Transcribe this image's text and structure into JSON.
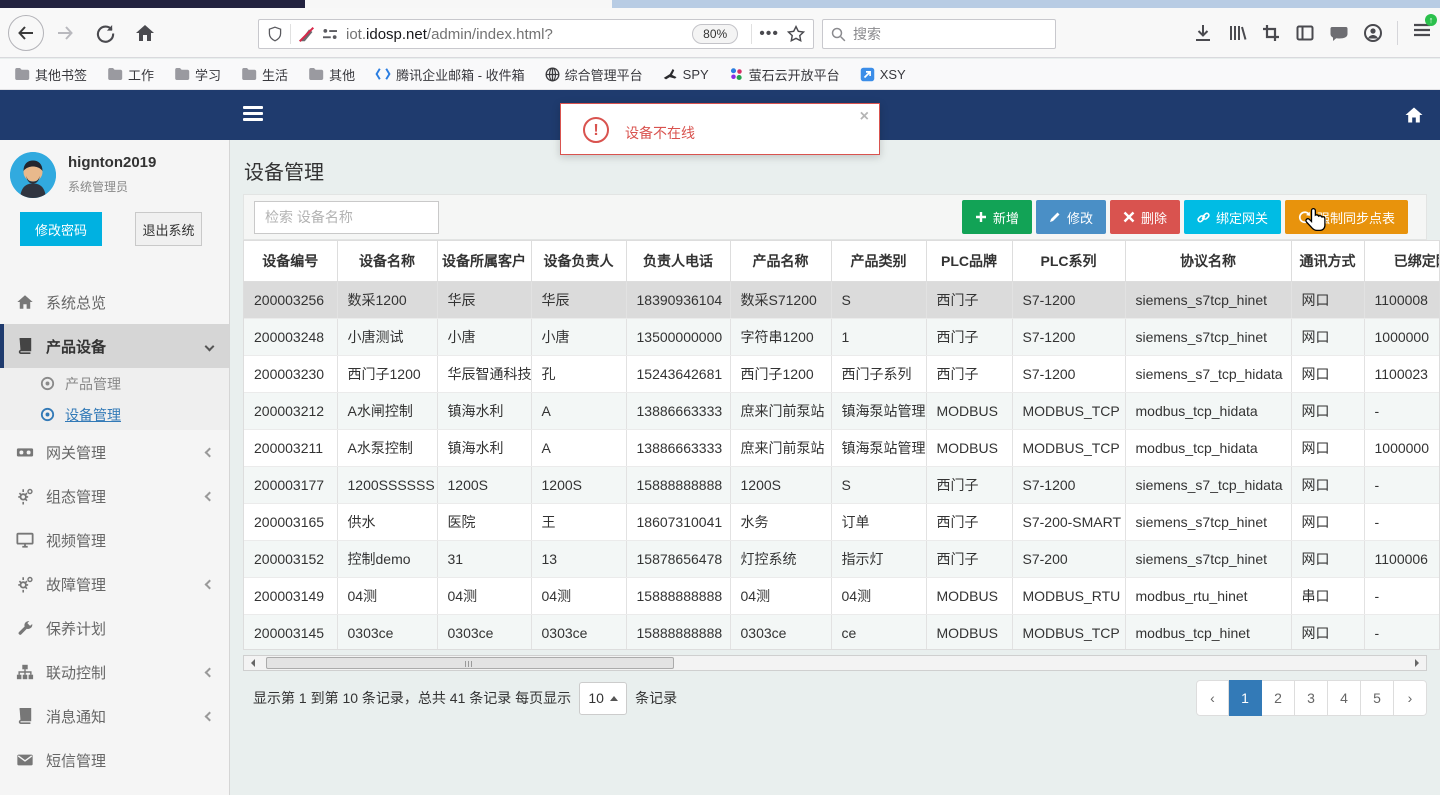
{
  "browser": {
    "url_prefix": "iot.",
    "url_domain": "idosp.net",
    "url_path": "/admin/index.html?",
    "zoom_level": "80%",
    "search_placeholder": "搜索",
    "bookmarks": [
      "其他书签",
      "工作",
      "学习",
      "生活",
      "其他",
      "腾讯企业邮箱 - 收件箱",
      "综合管理平台",
      "SPY",
      "萤石云开放平台",
      "XSY"
    ]
  },
  "app": {
    "alert": {
      "text": "设备不在线",
      "close": "×"
    },
    "user": {
      "name": "hignton2019",
      "role": "系统管理员",
      "change_password": "修改密码",
      "logout": "退出系统"
    },
    "menu": [
      {
        "label": "系统总览"
      },
      {
        "label": "产品设备"
      },
      {
        "label": "网关管理"
      },
      {
        "label": "组态管理"
      },
      {
        "label": "视频管理"
      },
      {
        "label": "故障管理"
      },
      {
        "label": "保养计划"
      },
      {
        "label": "联动控制"
      },
      {
        "label": "消息通知"
      },
      {
        "label": "短信管理"
      }
    ],
    "submenu": [
      {
        "label": "产品管理"
      },
      {
        "label": "设备管理"
      }
    ],
    "page": {
      "title": "设备管理",
      "search_placeholder": "检索 设备名称",
      "toolbar_buttons": [
        {
          "label": "新增",
          "color": "#12a356",
          "icon": "plus-icon"
        },
        {
          "label": "修改",
          "color": "#4a8fc6",
          "icon": "pencil-icon"
        },
        {
          "label": "删除",
          "color": "#d9534f",
          "icon": "x-icon"
        },
        {
          "label": "绑定网关",
          "color": "#00bce4",
          "icon": "link-icon"
        },
        {
          "label": "强制同步点表",
          "color": "#e8930c",
          "icon": "refresh-icon"
        }
      ],
      "table": {
        "headers": [
          "设备编号",
          "设备名称",
          "设备所属客户",
          "设备负责人",
          "负责人电话",
          "产品名称",
          "产品类别",
          "PLC品牌",
          "PLC系列",
          "协议名称",
          "通讯方式",
          "已绑定网关"
        ],
        "selected_row_index": 0,
        "rows": [
          [
            "200003256",
            "数采1200",
            "华辰",
            "华辰",
            "18390936104",
            "数采S71200",
            "S",
            "西门子",
            "S7-1200",
            "siemens_s7tcp_hinet",
            "网口",
            "1100008"
          ],
          [
            "200003248",
            "小唐测试",
            "小唐",
            "小唐",
            "13500000000",
            "字符串1200",
            "1",
            "西门子",
            "S7-1200",
            "siemens_s7tcp_hinet",
            "网口",
            "1000000"
          ],
          [
            "200003230",
            "西门子1200",
            "华辰智通科技",
            "孔",
            "15243642681",
            "西门子1200",
            "西门子系列",
            "西门子",
            "S7-1200",
            "siemens_s7_tcp_hidata",
            "网口",
            "1100023"
          ],
          [
            "200003212",
            "A水闸控制",
            "镇海水利",
            "A",
            "13886663333",
            "庶来门前泵站",
            "镇海泵站管理",
            "MODBUS",
            "MODBUS_TCP",
            "modbus_tcp_hidata",
            "网口",
            "-"
          ],
          [
            "200003211",
            "A水泵控制",
            "镇海水利",
            "A",
            "13886663333",
            "庶来门前泵站",
            "镇海泵站管理",
            "MODBUS",
            "MODBUS_TCP",
            "modbus_tcp_hidata",
            "网口",
            "1000000"
          ],
          [
            "200003177",
            "1200SSSSSS",
            "1200S",
            "1200S",
            "15888888888",
            "1200S",
            "S",
            "西门子",
            "S7-1200",
            "siemens_s7_tcp_hidata",
            "网口",
            "-"
          ],
          [
            "200003165",
            "供水",
            "医院",
            "王",
            "18607310041",
            "水务",
            "订单",
            "西门子",
            "S7-200-SMART",
            "siemens_s7tcp_hinet",
            "网口",
            "-"
          ],
          [
            "200003152",
            "控制demo",
            "31",
            "13",
            "15878656478",
            "灯控系统",
            "指示灯",
            "西门子",
            "S7-200",
            "siemens_s7tcp_hinet",
            "网口",
            "1100006"
          ],
          [
            "200003149",
            "04测",
            "04测",
            "04测",
            "15888888888",
            "04测",
            "04测",
            "MODBUS",
            "MODBUS_RTU",
            "modbus_rtu_hinet",
            "串口",
            "-"
          ],
          [
            "200003145",
            "0303ce",
            "0303ce",
            "0303ce",
            "15888888888",
            "0303ce",
            "ce",
            "MODBUS",
            "MODBUS_TCP",
            "modbus_tcp_hinet",
            "网口",
            "-"
          ]
        ]
      },
      "pagination": {
        "summary_prefix": "显示第 1 到第 10 条记录，总共 41 条记录 每页显示",
        "page_size": "10",
        "summary_suffix": "条记录",
        "prev": "‹",
        "next": "›",
        "pages": [
          "1",
          "2",
          "3",
          "4",
          "5"
        ],
        "active_page": "1"
      }
    }
  }
}
